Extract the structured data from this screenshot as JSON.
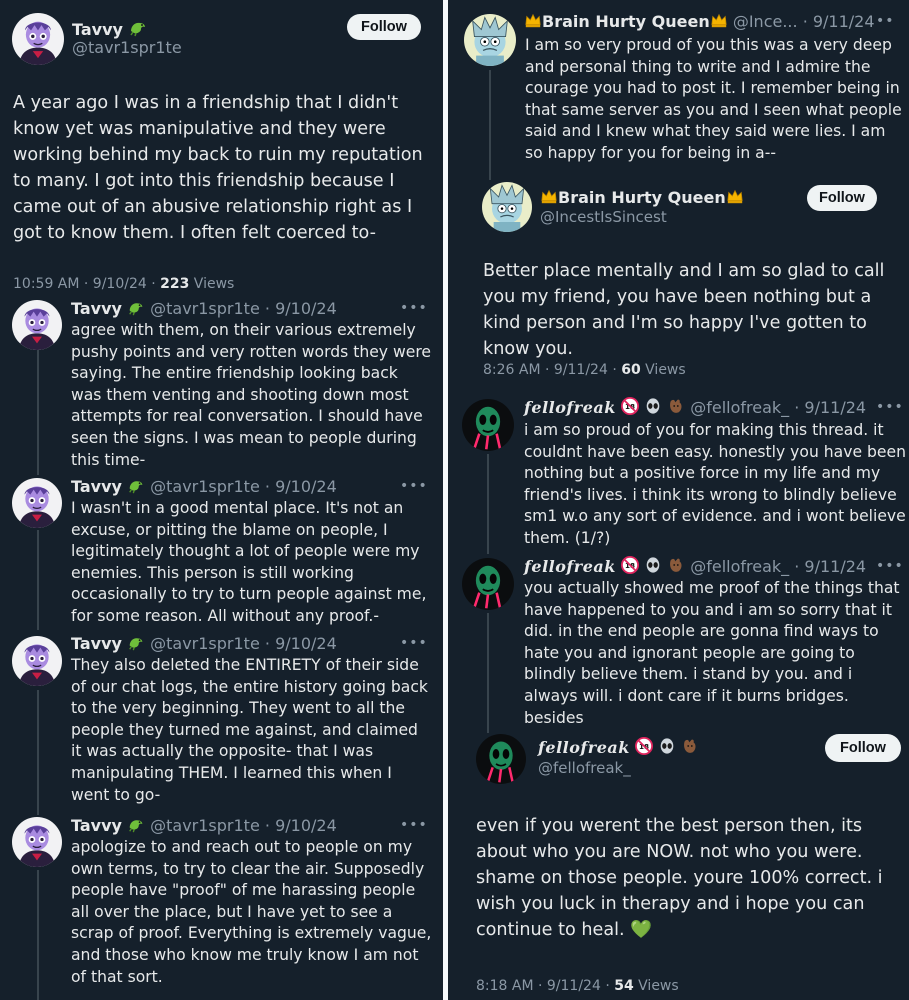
{
  "left": {
    "main": {
      "name": "Tavvy",
      "handle": "@tavr1spr1te",
      "follow_label": "Follow",
      "text": "A year ago I was in a friendship that I didn't know yet was manipulative and they were working behind my back to ruin my reputation to many. I got into this friendship because I came out of an abusive relationship right as I got to know them. I often felt coerced to-",
      "time_date": "10:59 AM · 9/10/24 · ",
      "views_count": "223",
      "views_label": " Views"
    },
    "replies": [
      {
        "name": "Tavvy",
        "handle": "@tavr1spr1te",
        "date": "· 9/10/24",
        "text": "agree with them, on their various extremely pushy points and very rotten words they were saying. The entire friendship looking back was them venting and shooting down most attempts for real conversation. I should have seen the signs. I was mean to people during this time-"
      },
      {
        "name": "Tavvy",
        "handle": "@tavr1spr1te",
        "date": "· 9/10/24",
        "text": "I wasn't in a good mental place. It's not an excuse, or pitting the blame on people, I legitimately thought a lot of people were my enemies. This person is still working occasionally to try to turn people against me, for some reason. All without any proof.-"
      },
      {
        "name": "Tavvy",
        "handle": "@tavr1spr1te",
        "date": "· 9/10/24",
        "text": "They also deleted the ENTIRETY of their side of our chat logs, the entire history going back to the very beginning. They went to all the people they turned me against, and claimed it was actually the opposite- that I was manipulating THEM. I learned this when I went to go-"
      },
      {
        "name": "Tavvy",
        "handle": "@tavr1spr1te",
        "date": "· 9/10/24",
        "text": "apologize to and reach out to people on my own terms, to try to clear the air. Supposedly people have \"proof\" of me harassing people all over the place, but I have yet to see a scrap of proof. Everything is extremely vague, and those who know me truly know I am not of that sort."
      }
    ]
  },
  "right": {
    "queen_reply": {
      "name": "Brain Hurty Queen",
      "handle": "@Ince...",
      "date": "· 9/11/24",
      "text": "I am so very proud of you this was a very deep and personal thing to write and I admire the courage you had to post it. I remember being in that same server as you and I seen what people said and I knew what they said were lies. I am so happy for you for being in a--"
    },
    "queen_main": {
      "name": "Brain Hurty Queen",
      "handle": "@IncestIsSincest",
      "follow_label": "Follow",
      "text": "Better place mentally and I am so glad to call you my friend, you have been nothing but a kind person and I'm so happy I've gotten to know you.",
      "time_date": "8:26 AM · 9/11/24 · ",
      "views_count": "60",
      "views_label": " Views"
    },
    "freak_replies": [
      {
        "name": "fellofreak",
        "handle": "@fellofreak_",
        "date": "· 9/11/24",
        "text": "i am so proud of you for making this thread. it couldnt have been easy. honestly you have been nothing but a positive force in my life and my friend's lives. i think its wrong to blindly believe sm1 w.o any sort of evidence. and i wont believe them. (1/?)"
      },
      {
        "name": "fellofreak",
        "handle": "@fellofreak_",
        "date": "· 9/11/24",
        "text": "you actually showed me proof of the things that have happened to you and i am so sorry that it did. in the end people are gonna find ways to hate you and ignorant people are going to blindly believe them. i stand by you. and i always will. i dont care if it burns bridges. besides"
      }
    ],
    "freak_main": {
      "name": "fellofreak",
      "handle": "@fellofreak_",
      "follow_label": "Follow",
      "text": "even if you werent the best person then, its about who you are NOW. not who you were. shame on those people. youre 100% correct. i wish you luck in therapy and i hope you can continue to heal.",
      "heart": "💚",
      "time_date": "8:18 AM · 9/11/24 · ",
      "views_count": "54",
      "views_label": " Views"
    }
  },
  "colors": {
    "background": "#15202b",
    "text": "#e7e9ea",
    "muted": "#8b98a5",
    "follow_bg": "#eff3f4",
    "thread_line": "#38444d"
  }
}
